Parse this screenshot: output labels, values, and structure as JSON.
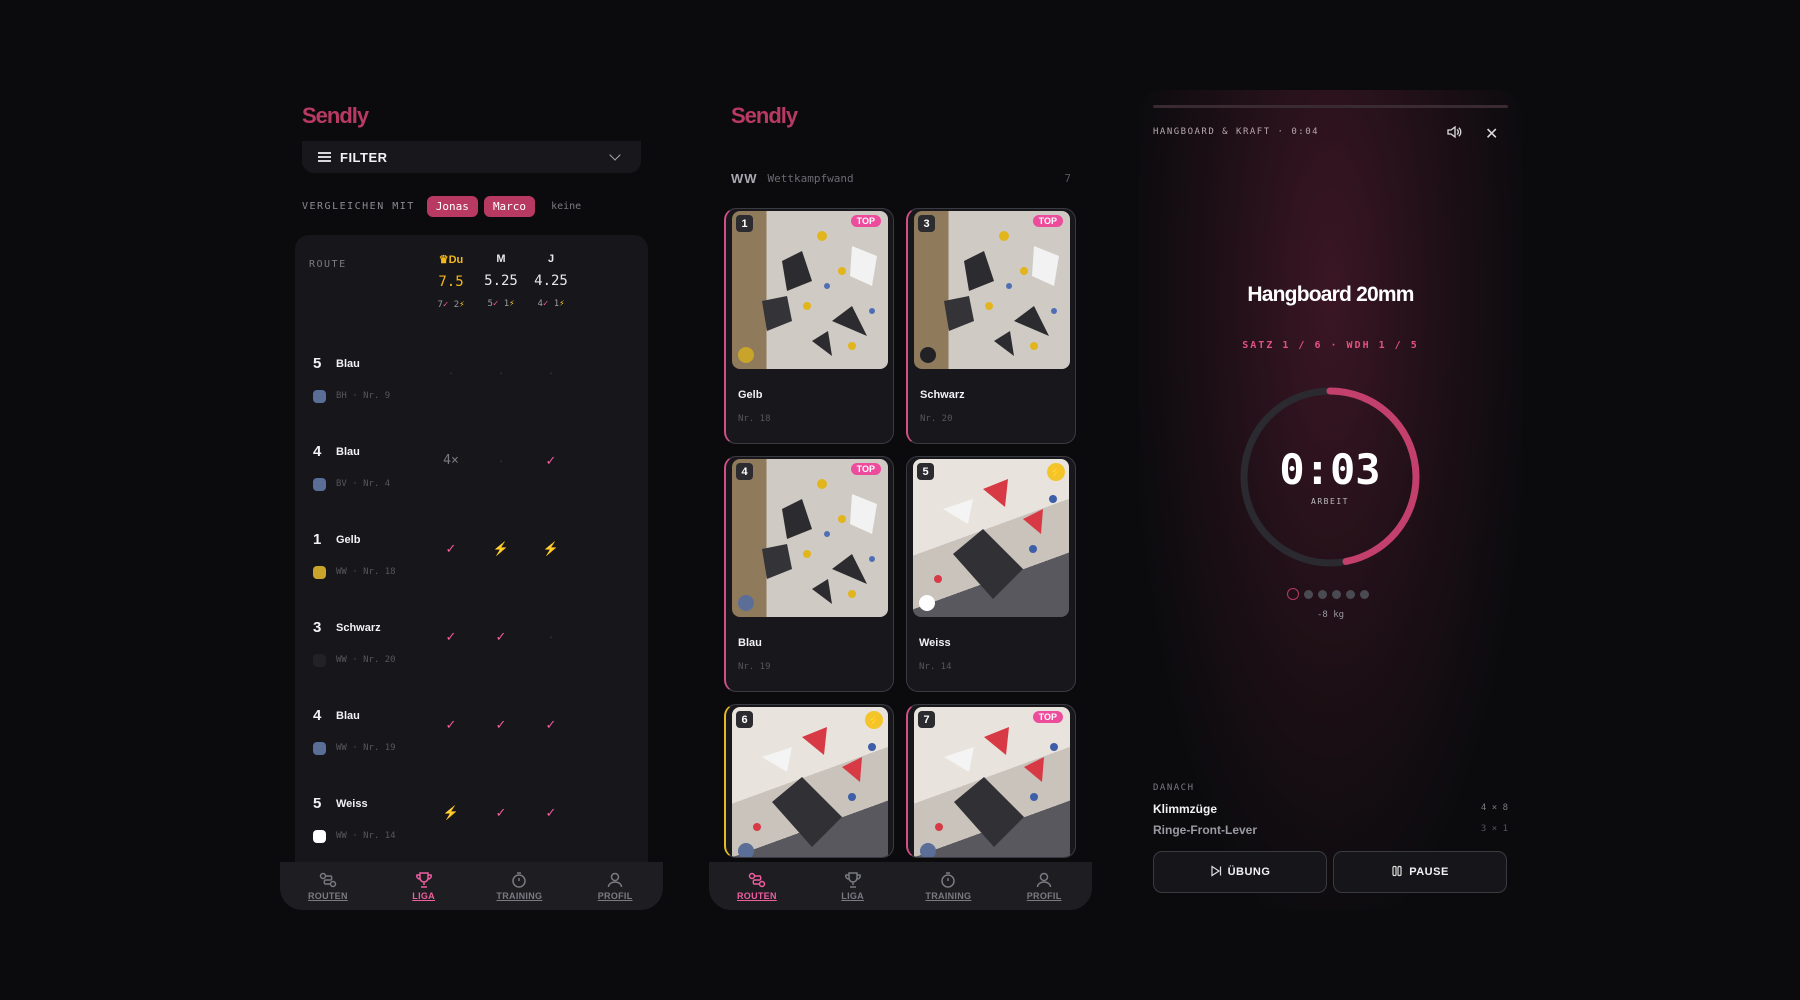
{
  "app": {
    "logo": "Sendly"
  },
  "liga": {
    "filter_label": "FILTER",
    "compare_label": "VERGLEICHEN MIT",
    "compare_pills": [
      "Jonas",
      "Marco"
    ],
    "compare_none": "keine",
    "route_header": "ROUTE",
    "columns": [
      {
        "name": "Du",
        "score": "7.5",
        "checks": "7",
        "flashes": "2"
      },
      {
        "name": "M",
        "score": "5.25",
        "checks": "5",
        "flashes": "1"
      },
      {
        "name": "J",
        "score": "4.25",
        "checks": "4",
        "flashes": "1"
      }
    ],
    "rows": [
      {
        "grade": "5",
        "name": "Blau",
        "meta": "BH · Nr. 9",
        "color": "#5a6e97",
        "cells": [
          "·",
          "·",
          "·"
        ]
      },
      {
        "grade": "4",
        "name": "Blau",
        "meta": "BV · Nr. 4",
        "color": "#5a6e97",
        "cells": [
          "4×",
          "·",
          "✓"
        ]
      },
      {
        "grade": "1",
        "name": "Gelb",
        "meta": "WW · Nr. 18",
        "color": "#c9a42a",
        "cells": [
          "✓",
          "⚡",
          "⚡"
        ]
      },
      {
        "grade": "3",
        "name": "Schwarz",
        "meta": "WW · Nr. 20",
        "color": "#222226",
        "cells": [
          "✓",
          "✓",
          "·"
        ]
      },
      {
        "grade": "4",
        "name": "Blau",
        "meta": "WW · Nr. 19",
        "color": "#5a6e97",
        "cells": [
          "✓",
          "✓",
          "✓"
        ]
      },
      {
        "grade": "5",
        "name": "Weiss",
        "meta": "WW · Nr. 14",
        "color": "#ffffff",
        "cells": [
          "⚡",
          "✓",
          "✓"
        ]
      }
    ]
  },
  "nav": {
    "items": [
      "ROUTEN",
      "LIGA",
      "TRAINING",
      "PROFIL"
    ]
  },
  "routen": {
    "wall_code": "WW",
    "wall_name": "Wettkampfwand",
    "wall_count": "7",
    "cards": [
      {
        "num": "1",
        "name": "Gelb",
        "meta": "Nr. 18",
        "badge": "TOP",
        "dot": "#c9a42a",
        "img": "A"
      },
      {
        "num": "3",
        "name": "Schwarz",
        "meta": "Nr. 20",
        "badge": "TOP",
        "dot": "#222226",
        "img": "A"
      },
      {
        "num": "4",
        "name": "Blau",
        "meta": "Nr. 19",
        "badge": "TOP",
        "dot": "#5a6e97",
        "img": "A"
      },
      {
        "num": "5",
        "name": "Weiss",
        "meta": "Nr. 14",
        "badge": "⚡",
        "dot": "#ffffff",
        "img": "B"
      },
      {
        "num": "6",
        "name": "",
        "meta": "",
        "badge": "⚡",
        "dot": "#5a6e97",
        "img": "B"
      },
      {
        "num": "7",
        "name": "",
        "meta": "",
        "badge": "TOP",
        "dot": "#5a6e97",
        "img": "B"
      }
    ]
  },
  "training": {
    "title": "HANGBOARD & KRAFT · 0:04",
    "exercise": "Hangboard 20mm",
    "set_info": "SATZ 1 / 6 · WDH 1 / 5",
    "timer": "0:03",
    "phase": "ARBEIT",
    "progress_fraction": 0.47,
    "rep_dots": 6,
    "weight": "-8 kg",
    "next_label": "DANACH",
    "next": [
      {
        "name": "Klimmzüge",
        "reps": "4 × 8"
      },
      {
        "name": "Ringe-Front-Lever",
        "reps": "3 × 1"
      }
    ],
    "btn_exercise": "ÜBUNG",
    "btn_pause": "PAUSE"
  },
  "colors": {
    "accent": "#b83a62",
    "pink": "#ee5fa0",
    "flash": "#f3c52a",
    "gold": "#f3b71c"
  }
}
